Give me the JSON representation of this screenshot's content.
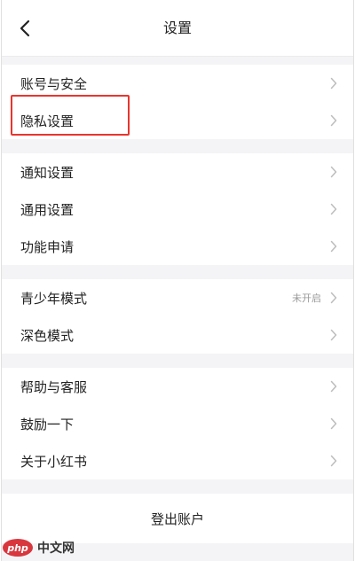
{
  "header": {
    "title": "设置",
    "back_icon": "chevron-left-icon"
  },
  "groups": [
    {
      "items": [
        {
          "label": "账号与安全",
          "status": ""
        },
        {
          "label": "隐私设置",
          "status": ""
        }
      ]
    },
    {
      "items": [
        {
          "label": "通知设置",
          "status": ""
        },
        {
          "label": "通用设置",
          "status": ""
        },
        {
          "label": "功能申请",
          "status": ""
        }
      ]
    },
    {
      "items": [
        {
          "label": "青少年模式",
          "status": "未开启"
        },
        {
          "label": "深色模式",
          "status": ""
        }
      ]
    },
    {
      "items": [
        {
          "label": "帮助与客服",
          "status": ""
        },
        {
          "label": "鼓励一下",
          "status": ""
        },
        {
          "label": "关于小红书",
          "status": ""
        }
      ]
    }
  ],
  "logout": {
    "label": "登出账户"
  },
  "highlight": {
    "target": "隐私设置",
    "color": "#e8352e"
  },
  "watermark": {
    "logo_text": "php",
    "site_text": "中文网"
  },
  "colors": {
    "background": "#f4f4f6",
    "text": "#222222",
    "chevron": "#bdbdbd",
    "status": "#9a9a9a"
  }
}
